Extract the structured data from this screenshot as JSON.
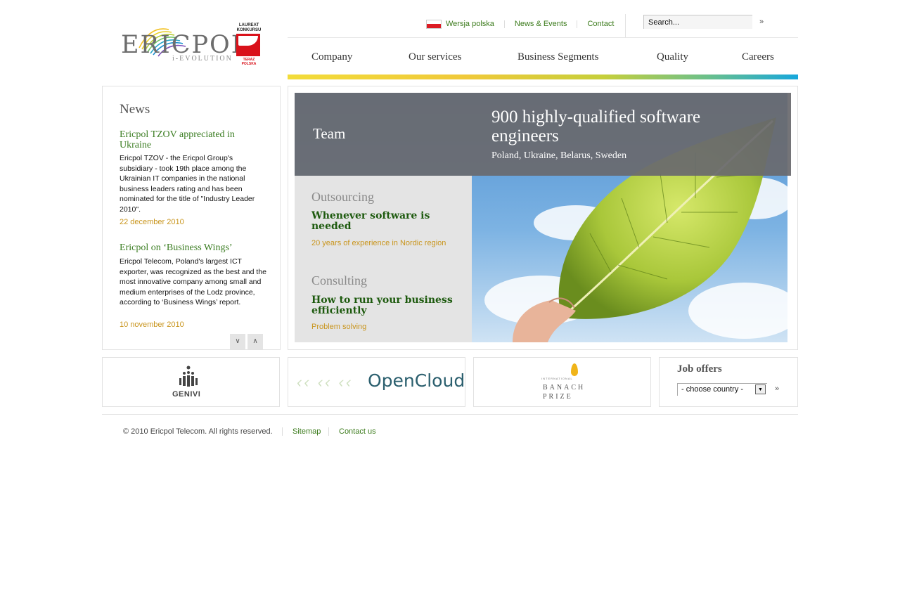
{
  "brand": {
    "logo_text": "ERICPOL",
    "tagline": "i-EVOLUTION",
    "award_lines": [
      "LAUREAT",
      "KONKURSU"
    ],
    "award_sub": "TERAZ POLSKA"
  },
  "top_links": {
    "polish": "Wersja polska",
    "news": "News & Events",
    "contact": "Contact"
  },
  "search": {
    "value": "Search...",
    "go_icon": "double-arrow-right-icon"
  },
  "nav": [
    "Company",
    "Our services",
    "Business Segments",
    "Quality",
    "Careers"
  ],
  "news": {
    "title": "News",
    "items": [
      {
        "headline": "Ericpol TZOV appreciated in Ukraine",
        "body": "Ericpol TZOV - the Ericpol Group's subsidiary - took 19th place among the Ukrainian IT companies in the national business leaders rating and has been nominated for the title of \"Industry Leader 2010\".",
        "date": "22 december 2010"
      },
      {
        "headline": "Ericpol on ‘Business Wings’",
        "body": "Ericpol Telecom, Poland's largest ICT exporter, was recognized as the best and the most innovative company among small and medium enterprises of the Lodz province, according to ‘Business Wings’ report.",
        "date": "10 november 2010"
      }
    ],
    "down_icon": "double-chevron-down-icon",
    "up_icon": "double-chevron-up-icon"
  },
  "hero": {
    "label": "Team",
    "headline": "900 highly-qualified software engineers",
    "sub": "Poland, Ukraine, Belarus, Sweden",
    "sections": [
      {
        "title": "Outsourcing",
        "headline": "Whenever software is needed",
        "link": "20 years of experience in Nordic region"
      },
      {
        "title": "Consulting",
        "headline": "How to run your business efficiently",
        "link": "Problem solving"
      }
    ]
  },
  "partners": {
    "genivi": "GENIVI",
    "opencloud": "OpenCloud",
    "banach_top": "INTERNATIONAL",
    "banach_1": "BANACH",
    "banach_2": "PRIZE"
  },
  "jobs": {
    "title": "Job offers",
    "select_value": "- choose country -",
    "go_icon": "double-arrow-right-icon"
  },
  "footer": {
    "copyright": "© 2010 Ericpol Telecom. All rights reserved.",
    "sitemap": "Sitemap",
    "contact": "Contact us"
  },
  "colors": {
    "link_green": "#3a7a1a",
    "date_gold": "#c9951d",
    "headline_green": "#1d5a0e",
    "brand_red": "#d9111a"
  }
}
